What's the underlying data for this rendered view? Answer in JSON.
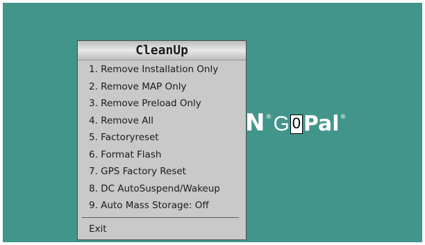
{
  "background_color": "#42958b",
  "brand": {
    "letter": "N",
    "reg_mark": "®",
    "go": "Go",
    "caret_char": "0",
    "pal": "Pal"
  },
  "menu": {
    "title": "CleanUp",
    "items": [
      "1. Remove Installation Only",
      "2. Remove MAP Only",
      "3. Remove Preload Only",
      "4. Remove All",
      "5. Factoryreset",
      "6. Format Flash",
      "7. GPS Factory Reset",
      "8. DC AutoSuspend/Wakeup",
      "9. Auto Mass Storage: Off"
    ],
    "exit_label": "Exit"
  }
}
